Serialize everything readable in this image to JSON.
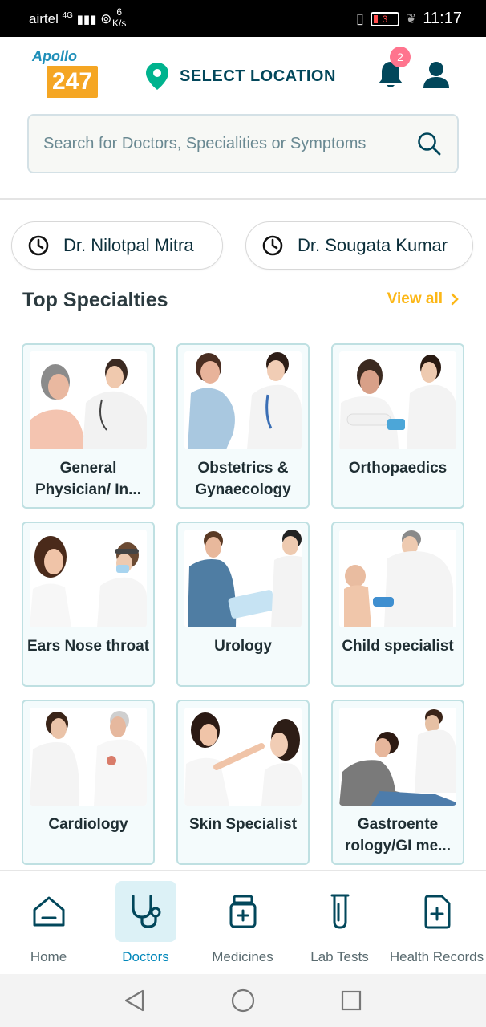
{
  "status_bar": {
    "carrier": "airtel",
    "network": "4G",
    "speed_value": "6",
    "speed_unit": "K/s",
    "battery": "3",
    "time": "11:17"
  },
  "header": {
    "logo_top": "Apollo",
    "logo_number": "247",
    "location_label": "SELECT LOCATION",
    "notification_count": "2"
  },
  "search": {
    "placeholder": "Search for Doctors, Specialities or Symptoms"
  },
  "recent_doctors": [
    {
      "name": "Dr. Nilotpal Mitra"
    },
    {
      "name": "Dr. Sougata Kumar"
    }
  ],
  "specialties": {
    "title": "Top Specialties",
    "view_all": "View all",
    "items": [
      {
        "label": "General Physician/ In...",
        "icon": "doctor-patient-photo"
      },
      {
        "label": "Obstetrics & Gynaecology",
        "icon": "pregnant-patient-photo"
      },
      {
        "label": "Orthopaedics",
        "icon": "arm-bandage-photo"
      },
      {
        "label": "Ears Nose throat",
        "icon": "ent-exam-photo"
      },
      {
        "label": "Urology",
        "icon": "urology-consult-photo"
      },
      {
        "label": "Child specialist",
        "icon": "baby-checkup-photo"
      },
      {
        "label": "Cardiology",
        "icon": "heart-checkup-photo"
      },
      {
        "label": "Skin Specialist",
        "icon": "skin-exam-photo"
      },
      {
        "label": "Gastroente rology/GI me...",
        "icon": "stomach-pain-photo"
      }
    ]
  },
  "bottom_nav": [
    {
      "label": "Home",
      "icon": "home-icon",
      "active": false
    },
    {
      "label": "Doctors",
      "icon": "stethoscope-icon",
      "active": true
    },
    {
      "label": "Medicines",
      "icon": "medicine-bottle-icon",
      "active": false
    },
    {
      "label": "Lab Tests",
      "icon": "test-tube-icon",
      "active": false
    },
    {
      "label": "Health Records",
      "icon": "health-record-icon",
      "active": false
    }
  ],
  "colors": {
    "brand_dark": "#02475b",
    "accent_orange": "#fcb716",
    "active_blue": "#0087ba",
    "card_border": "#bfe0e2",
    "location_pin": "#00b38e"
  }
}
